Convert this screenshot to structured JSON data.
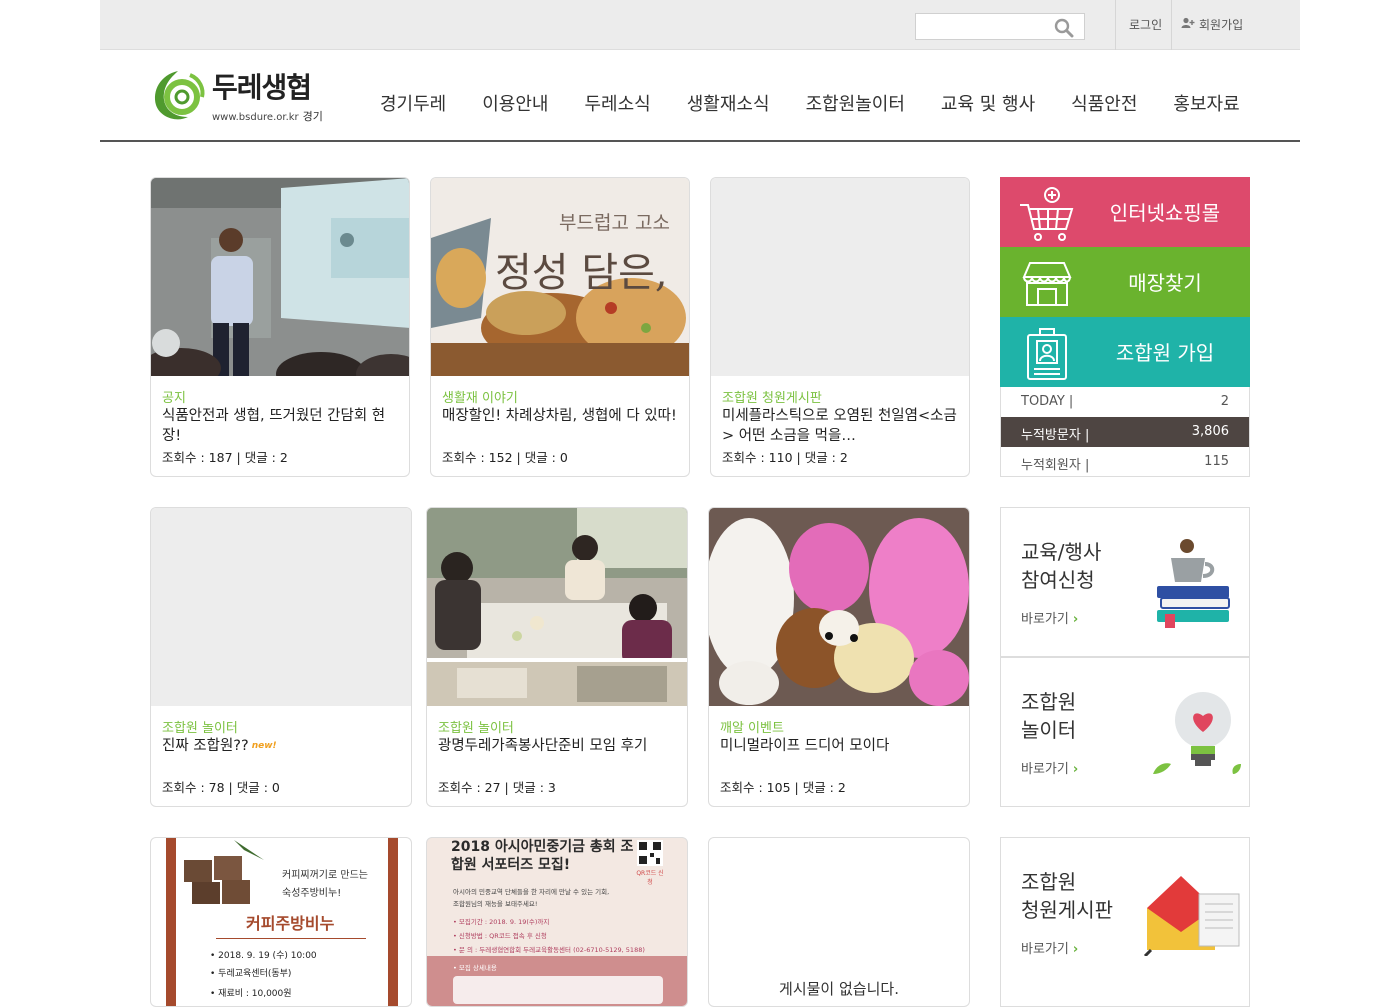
{
  "search": {
    "placeholder": ""
  },
  "top": {
    "login": "로그인",
    "join": "회원가입"
  },
  "logo": {
    "brand": "두레생협",
    "url": "www.bsdure.or.kr",
    "region": "경기"
  },
  "nav": [
    "경기두레",
    "이용안내",
    "두레소식",
    "생활재소식",
    "조합원놀이터",
    "교육 및 행사",
    "식품안전",
    "홍보자료"
  ],
  "cards": [
    {
      "category": "공지",
      "title": "식품안전과 생협, 뜨거웠던 간담회 현장!",
      "views_label": "조회수 : 187",
      "comments_label": "댓글 : 2"
    },
    {
      "category": "생활재 이야기",
      "title": "매장할인! 차례상차림, 생협에 다 있따!",
      "views_label": "조회수 : 152",
      "comments_label": "댓글 : 0",
      "thumb_text_1": "부드럽고 고소",
      "thumb_text_2": "정성 담은,"
    },
    {
      "category": "조합원 청원게시판",
      "title": "미세플라스틱으로 오염된 천일염<소금> 어떤 소금을 먹을…",
      "views_label": "조회수 : 110",
      "comments_label": "댓글 : 2"
    },
    {
      "category": "조합원 놀이터",
      "title": "진짜 조합원??",
      "badge": "new!",
      "views_label": "조회수 : 78",
      "comments_label": "댓글 : 0"
    },
    {
      "category": "조합원 놀이터",
      "title": "광명두레가족봉사단준비 모임 후기",
      "views_label": "조회수 : 27",
      "comments_label": "댓글 : 3"
    },
    {
      "category": "깨알 이벤트",
      "title": "미니멀라이프 드디어 모이다",
      "views_label": "조회수 : 105",
      "comments_label": "댓글 : 2"
    },
    {
      "poster_line1": "커피찌꺼기로 만드는",
      "poster_line2": "숙성주방비누!",
      "poster_title": "커피주방비누",
      "poster_date": "• 2018. 9. 19 (수) 10:00",
      "poster_place": "• 두레교육센터(동부)",
      "poster_fee": "• 재료비 : 10,000원"
    },
    {
      "poster_title": "2018 아시아민중기금 총회 조합원 서포터즈 모집!",
      "poster_body_1": "아시아의 민중교역 단체들을 한 자리에 만날 수 있는 기회,",
      "poster_body_2": "조합원님의 재능을 보태주세요!",
      "poster_line_a": "• 모집기간 : 2018. 9. 19(수)까지",
      "poster_line_b": "• 신청방법 : QR코드 접속 후 신청",
      "poster_line_c": "• 문    의 : 두레생협연합회 두레교육활동센터 (02-6710-5129, 5188)",
      "poster_qr_label": "QR코드 신청",
      "poster_detail": "• 모집 상세내용"
    },
    {
      "empty": "게시물이 없습니다."
    }
  ],
  "side": {
    "shop": "인터넷쇼핑몰",
    "store": "매장찾기",
    "join": "조합원 가입",
    "colors": {
      "shop": "#dd4a6c",
      "store": "#6ab32e",
      "join": "#1fb3a8"
    }
  },
  "stats": [
    {
      "key": "TODAY",
      "value": "2"
    },
    {
      "key": "누적방문자",
      "value": "3,806"
    },
    {
      "key": "누적회원자",
      "value": "115"
    }
  ],
  "promos": [
    {
      "title_1": "교육/행사",
      "title_2": "참여신청",
      "go": "바로가기"
    },
    {
      "title_1": "조합원",
      "title_2": "놀이터",
      "go": "바로가기"
    },
    {
      "title_1": "조합원",
      "title_2": "청원게시판",
      "go": "바로가기"
    }
  ]
}
